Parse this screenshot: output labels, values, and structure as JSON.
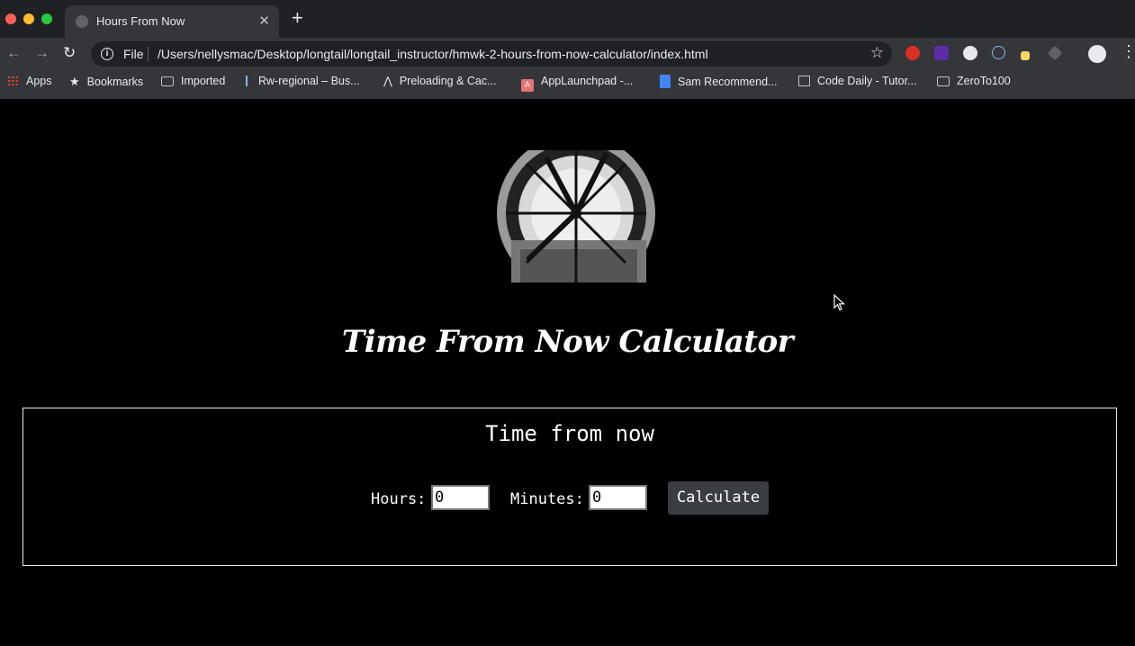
{
  "browser": {
    "tab_title": "Hours From Now",
    "new_tab_icon": "plus-icon",
    "scheme_label": "File",
    "url": "/Users/nellysmac/Desktop/longtail/longtail_instructor/hmwk-2-hours-from-now-calculator/index.html",
    "bookmarks": [
      {
        "label": "Apps",
        "icon": "apps-grid-icon"
      },
      {
        "label": "Bookmarks",
        "icon": "star-icon"
      },
      {
        "label": "Imported",
        "icon": "folder-icon"
      },
      {
        "label": "Rw-regional – Bus...",
        "icon": "site-favicon"
      },
      {
        "label": "Preloading & Cac...",
        "icon": "site-favicon"
      },
      {
        "label": "AppLaunchpad -...",
        "icon": "site-favicon"
      },
      {
        "label": "Sam Recommend...",
        "icon": "google-docs-icon"
      },
      {
        "label": "Code Daily - Tutor...",
        "icon": "site-favicon"
      },
      {
        "label": "ZeroTo100",
        "icon": "folder-icon"
      }
    ]
  },
  "page": {
    "heading": "Time From Now Calculator",
    "calculator": {
      "title": "Time from now",
      "hours_label": "Hours:",
      "hours_value": "0",
      "minutes_label": "Minutes:",
      "minutes_value": "0",
      "calculate_label": "Calculate"
    }
  },
  "colors": {
    "background": "#000000",
    "chrome": "#35363a",
    "button": "#3a3d42"
  }
}
